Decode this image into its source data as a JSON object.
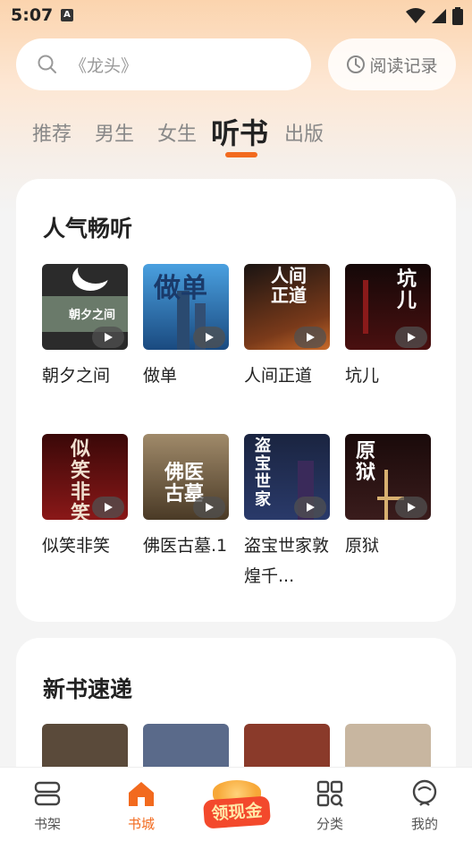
{
  "status_bar": {
    "time": "5:07",
    "notif_icon": "A"
  },
  "search": {
    "placeholder": "《龙头》"
  },
  "history_button": {
    "label": "阅读记录"
  },
  "tabs": [
    {
      "label": "推荐",
      "active": false
    },
    {
      "label": "男生",
      "active": false
    },
    {
      "label": "女生",
      "active": false
    },
    {
      "label": "听书",
      "active": true
    },
    {
      "label": "出版",
      "active": false
    }
  ],
  "popular": {
    "title": "人气畅听",
    "books": [
      {
        "name": "朝夕之间",
        "cover_text": "朝夕之间",
        "cover_color": "#3a3a3a"
      },
      {
        "name": "做单",
        "cover_text": "做单",
        "cover_color": "#2f6fa8"
      },
      {
        "name": "人间正道",
        "cover_text": "人间正道",
        "cover_color": "#7a3a1a"
      },
      {
        "name": "坑儿",
        "cover_text": "坑儿",
        "cover_color": "#3a1414"
      },
      {
        "name": "似笑非笑",
        "cover_text": "似笑非笑",
        "cover_color": "#5a1010"
      },
      {
        "name": "佛医古墓.1",
        "cover_text": "佛医古墓",
        "cover_color": "#6a5436"
      },
      {
        "name": "盗宝世家敦煌千...",
        "cover_text": "盗宝世家",
        "cover_color": "#1e2a4a"
      },
      {
        "name": "原狱",
        "cover_text": "原狱",
        "cover_color": "#2a1414"
      }
    ]
  },
  "new_books": {
    "title": "新书速递",
    "covers": [
      "#5a4a3a",
      "#5a6a8a",
      "#8a3a2a",
      "#c8b6a0"
    ]
  },
  "nav": {
    "items": [
      {
        "label": "书架",
        "icon": "bookshelf-icon",
        "active": false
      },
      {
        "label": "书城",
        "icon": "home-icon",
        "active": true
      },
      {
        "label": "领现金",
        "icon": "cash-bag-icon",
        "active": false
      },
      {
        "label": "分类",
        "icon": "category-icon",
        "active": false
      },
      {
        "label": "我的",
        "icon": "profile-icon",
        "active": false
      }
    ]
  },
  "colors": {
    "accent": "#f26a1e"
  }
}
